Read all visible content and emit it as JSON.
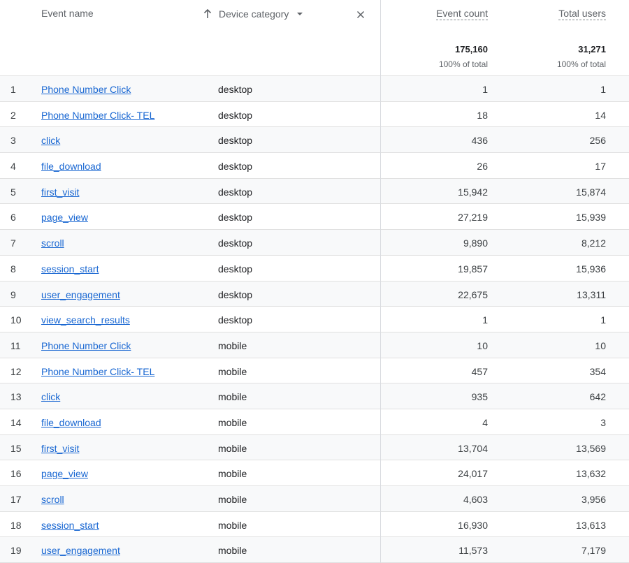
{
  "header": {
    "event_name_label": "Event name",
    "device_category_label": "Device category",
    "event_count_label": "Event count",
    "total_users_label": "Total users",
    "totals": {
      "event_count": "175,160",
      "event_count_pct": "100% of total",
      "total_users": "31,271",
      "total_users_pct": "100% of total"
    },
    "icons": {
      "sort": "arrow-up-icon",
      "dropdown": "caret-down-icon",
      "remove": "close-icon"
    }
  },
  "colors": {
    "link": "#1967d2",
    "row_alt": "#f8f9fa",
    "divider": "#e0e0e0"
  },
  "rows": [
    {
      "index": "1",
      "event_name": "Phone Number Click",
      "device": "desktop",
      "event_count": "1",
      "total_users": "1"
    },
    {
      "index": "2",
      "event_name": "Phone Number Click- TEL",
      "device": "desktop",
      "event_count": "18",
      "total_users": "14"
    },
    {
      "index": "3",
      "event_name": "click",
      "device": "desktop",
      "event_count": "436",
      "total_users": "256"
    },
    {
      "index": "4",
      "event_name": "file_download",
      "device": "desktop",
      "event_count": "26",
      "total_users": "17"
    },
    {
      "index": "5",
      "event_name": "first_visit",
      "device": "desktop",
      "event_count": "15,942",
      "total_users": "15,874"
    },
    {
      "index": "6",
      "event_name": "page_view",
      "device": "desktop",
      "event_count": "27,219",
      "total_users": "15,939"
    },
    {
      "index": "7",
      "event_name": "scroll",
      "device": "desktop",
      "event_count": "9,890",
      "total_users": "8,212"
    },
    {
      "index": "8",
      "event_name": "session_start",
      "device": "desktop",
      "event_count": "19,857",
      "total_users": "15,936"
    },
    {
      "index": "9",
      "event_name": "user_engagement",
      "device": "desktop",
      "event_count": "22,675",
      "total_users": "13,311"
    },
    {
      "index": "10",
      "event_name": "view_search_results",
      "device": "desktop",
      "event_count": "1",
      "total_users": "1"
    },
    {
      "index": "11",
      "event_name": "Phone Number Click",
      "device": "mobile",
      "event_count": "10",
      "total_users": "10"
    },
    {
      "index": "12",
      "event_name": "Phone Number Click- TEL",
      "device": "mobile",
      "event_count": "457",
      "total_users": "354"
    },
    {
      "index": "13",
      "event_name": "click",
      "device": "mobile",
      "event_count": "935",
      "total_users": "642"
    },
    {
      "index": "14",
      "event_name": "file_download",
      "device": "mobile",
      "event_count": "4",
      "total_users": "3"
    },
    {
      "index": "15",
      "event_name": "first_visit",
      "device": "mobile",
      "event_count": "13,704",
      "total_users": "13,569"
    },
    {
      "index": "16",
      "event_name": "page_view",
      "device": "mobile",
      "event_count": "24,017",
      "total_users": "13,632"
    },
    {
      "index": "17",
      "event_name": "scroll",
      "device": "mobile",
      "event_count": "4,603",
      "total_users": "3,956"
    },
    {
      "index": "18",
      "event_name": "session_start",
      "device": "mobile",
      "event_count": "16,930",
      "total_users": "13,613"
    },
    {
      "index": "19",
      "event_name": "user_engagement",
      "device": "mobile",
      "event_count": "11,573",
      "total_users": "7,179"
    }
  ]
}
